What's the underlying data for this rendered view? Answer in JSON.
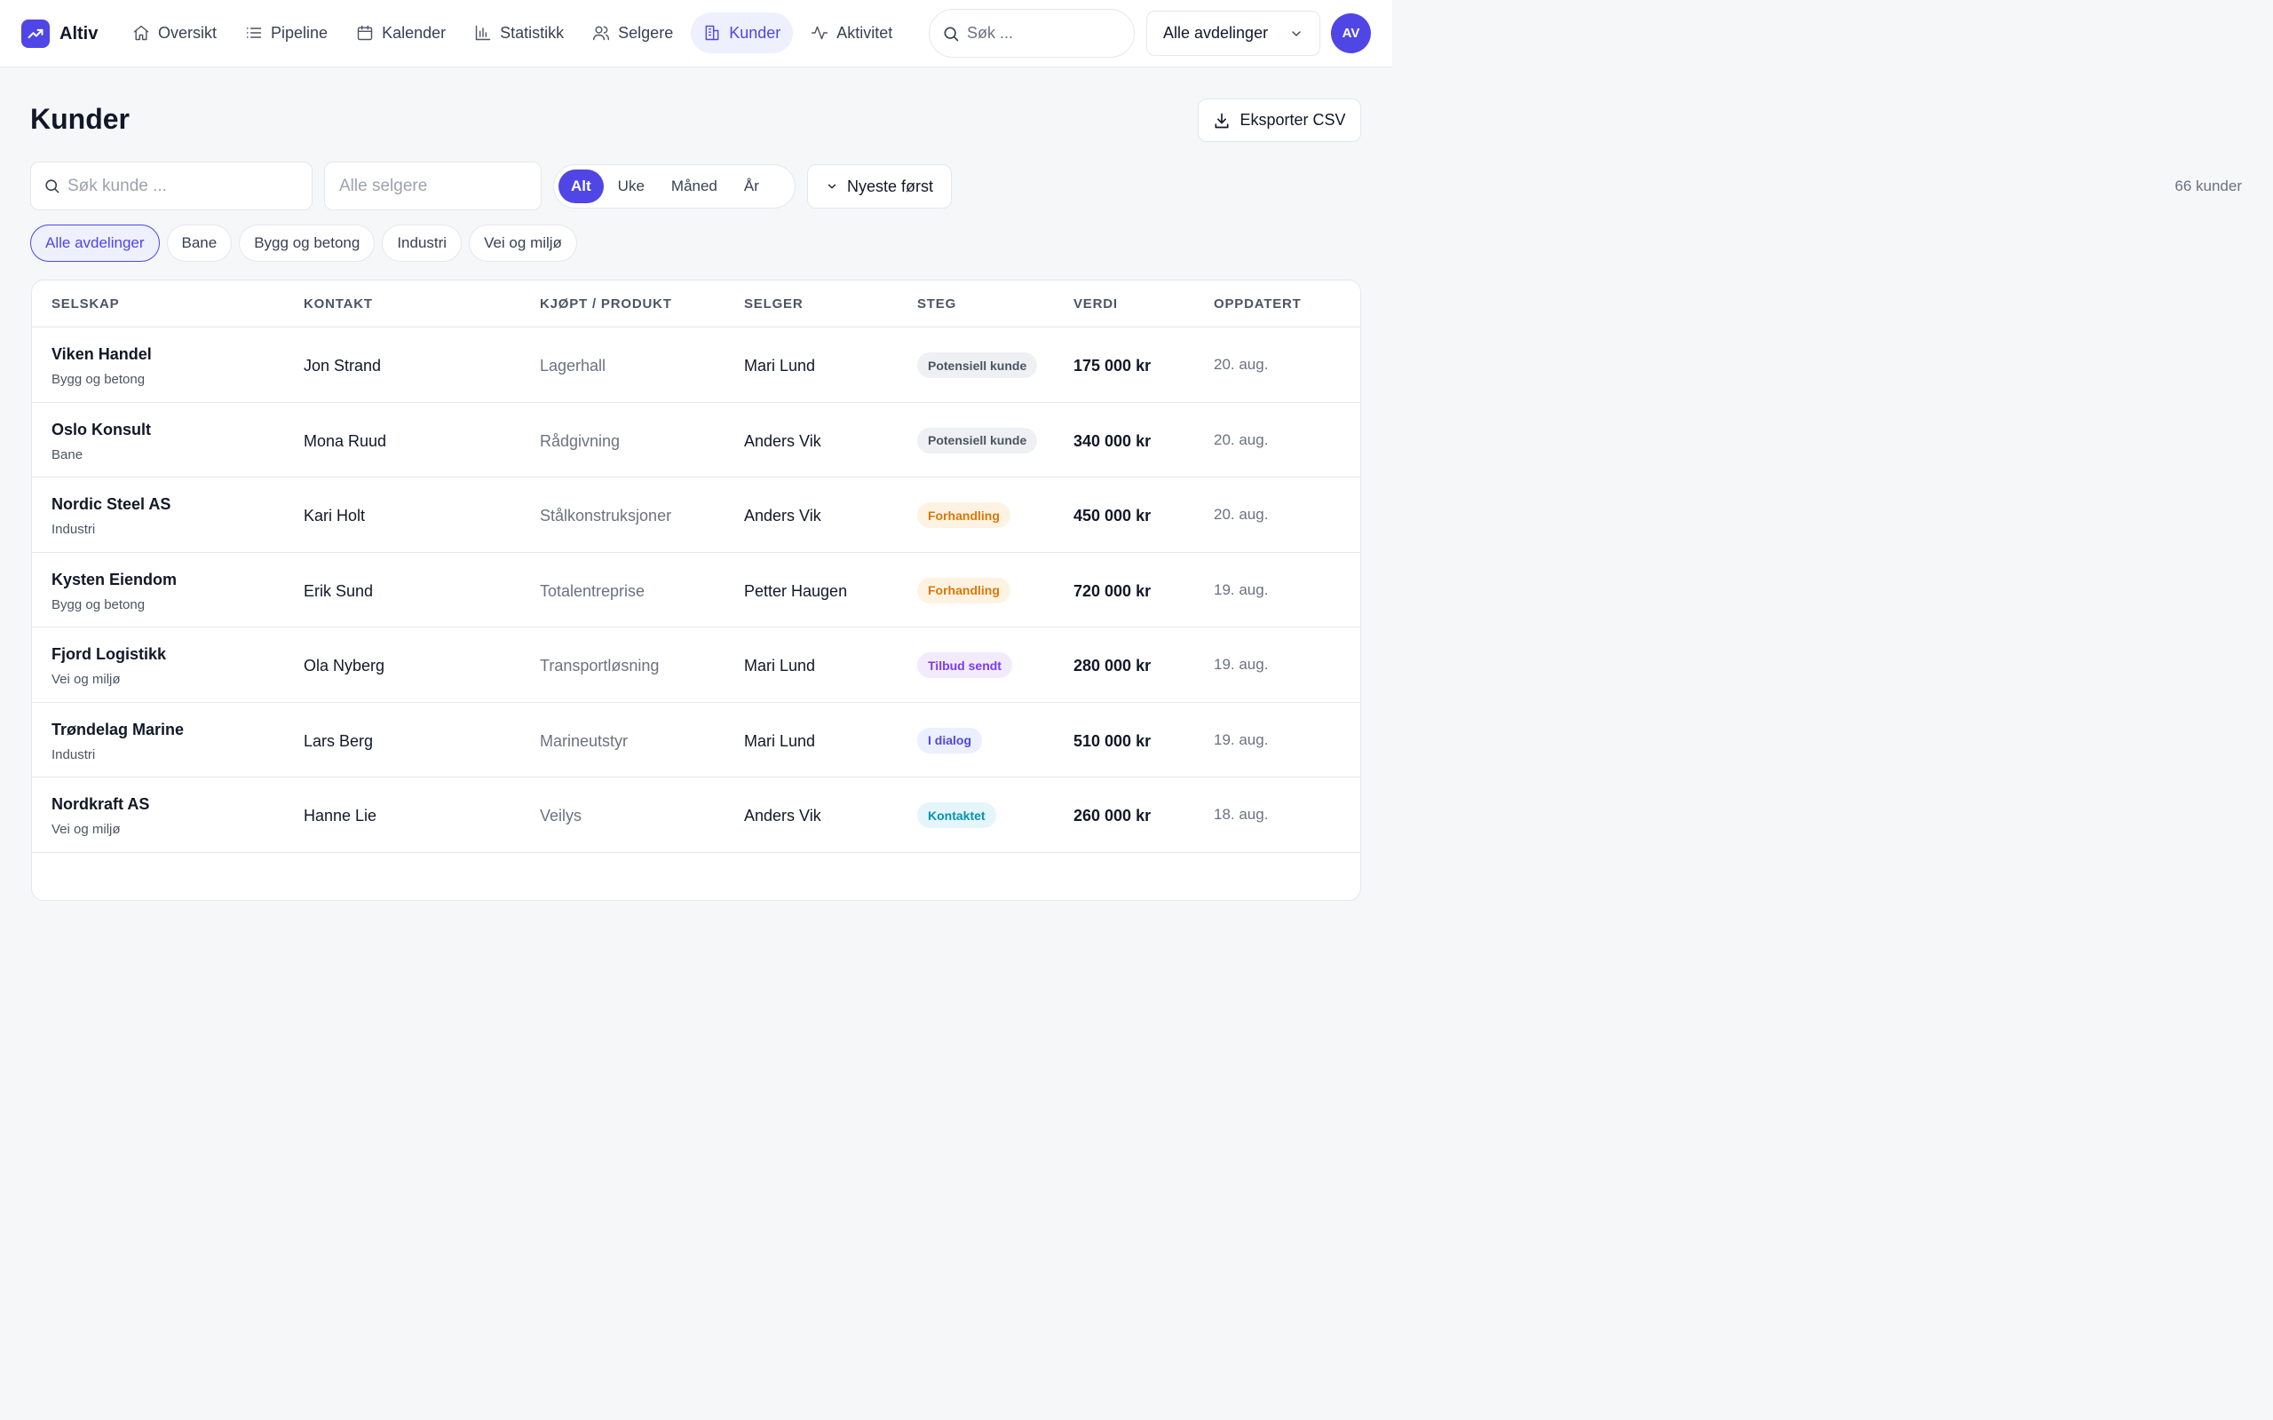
{
  "app": {
    "name": "Altiv"
  },
  "nav": {
    "items": [
      {
        "label": "Oversikt",
        "icon": "home-icon"
      },
      {
        "label": "Pipeline",
        "icon": "list-icon"
      },
      {
        "label": "Kalender",
        "icon": "calendar-icon"
      },
      {
        "label": "Statistikk",
        "icon": "bar-chart-icon"
      },
      {
        "label": "Selgere",
        "icon": "users-icon"
      },
      {
        "label": "Kunder",
        "icon": "building-icon"
      },
      {
        "label": "Aktivitet",
        "icon": "activity-icon"
      }
    ],
    "active": "Kunder",
    "search_placeholder": "Søk ...",
    "department_select": "Alle avdelinger",
    "avatar_initials": "AV"
  },
  "page": {
    "title": "Kunder",
    "export_label": "Eksporter CSV",
    "customer_search_placeholder": "Søk kunde ...",
    "seller_placeholder": "Alle selgere",
    "periods": [
      "Alt",
      "Uke",
      "Måned",
      "År"
    ],
    "active_period": "Alt",
    "sort_label": "Nyeste først",
    "count_label": "66 kunder",
    "departments": [
      "Alle avdelinger",
      "Bane",
      "Bygg og betong",
      "Industri",
      "Vei og miljø"
    ],
    "active_department": "Alle avdelinger"
  },
  "table": {
    "headers": [
      "SELSKAP",
      "KONTAKT",
      "KJØPT / PRODUKT",
      "SELGER",
      "STEG",
      "VERDI",
      "OPPDATERT"
    ],
    "rows": [
      {
        "company": "Viken Handel",
        "dept": "Bygg og betong",
        "contact": "Jon Strand",
        "product": "Lagerhall",
        "seller": "Mari Lund",
        "stage": "Potensiell kunde",
        "value": "175 000 kr",
        "updated": "20. aug."
      },
      {
        "company": "Oslo Konsult",
        "dept": "Bane",
        "contact": "Mona Ruud",
        "product": "Rådgivning",
        "seller": "Anders Vik",
        "stage": "Potensiell kunde",
        "value": "340 000 kr",
        "updated": "20. aug."
      },
      {
        "company": "Nordic Steel AS",
        "dept": "Industri",
        "contact": "Kari Holt",
        "product": "Stålkonstruksjoner",
        "seller": "Anders Vik",
        "stage": "Forhandling",
        "value": "450 000 kr",
        "updated": "20. aug."
      },
      {
        "company": "Kysten Eiendom",
        "dept": "Bygg og betong",
        "contact": "Erik Sund",
        "product": "Totalentreprise",
        "seller": "Petter Haugen",
        "stage": "Forhandling",
        "value": "720 000 kr",
        "updated": "19. aug."
      },
      {
        "company": "Fjord Logistikk",
        "dept": "Vei og miljø",
        "contact": "Ola Nyberg",
        "product": "Transportløsning",
        "seller": "Mari Lund",
        "stage": "Tilbud sendt",
        "value": "280 000 kr",
        "updated": "19. aug."
      },
      {
        "company": "Trøndelag Marine",
        "dept": "Industri",
        "contact": "Lars Berg",
        "product": "Marineutstyr",
        "seller": "Mari Lund",
        "stage": "I dialog",
        "value": "510 000 kr",
        "updated": "19. aug."
      },
      {
        "company": "Nordkraft AS",
        "dept": "Vei og miljø",
        "contact": "Hanne Lie",
        "product": "Veilys",
        "seller": "Anders Vik",
        "stage": "Kontaktet",
        "value": "260 000 kr",
        "updated": "18. aug."
      }
    ]
  },
  "stage_colors": {
    "Potensiell kunde": {
      "bg": "#eef0f3",
      "fg": "#4b5563"
    },
    "Forhandling": {
      "bg": "#fef3e2",
      "fg": "#d97706"
    },
    "Tilbud sendt": {
      "bg": "#f1ebfd",
      "fg": "#7c3aed"
    },
    "I dialog": {
      "bg": "#eceffd",
      "fg": "#4f46e5"
    },
    "Kontaktet": {
      "bg": "#e4f5fb",
      "fg": "#0891b2"
    }
  },
  "colors": {
    "accent": "#4f46e5"
  }
}
